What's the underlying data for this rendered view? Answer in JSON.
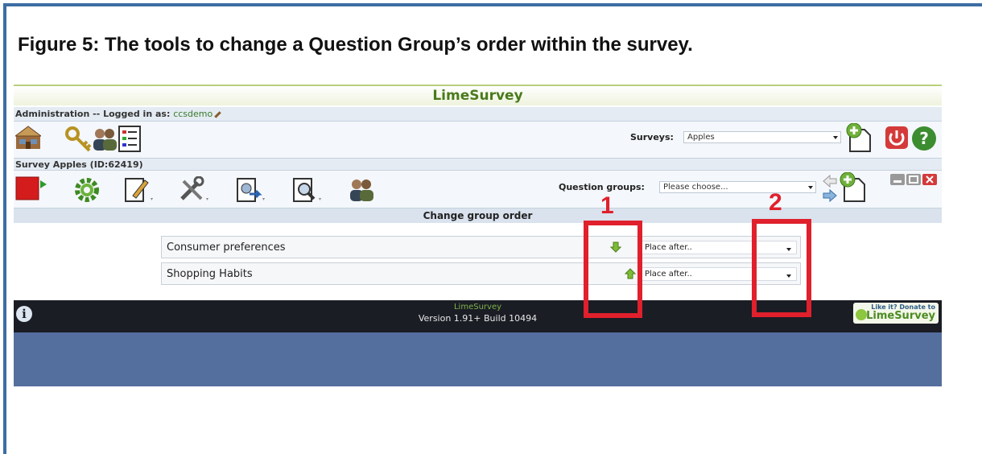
{
  "caption": "Figure 5:  The tools to change a Question Group’s order within the survey.",
  "app": {
    "title": "LimeSurvey",
    "admin_prefix": "Administration -- Logged in as: ",
    "username": "ccsdemo",
    "surveys_label": "Surveys:",
    "surveys_selected": "Apples",
    "survey_heading": "Survey Apples (ID:62419)",
    "question_groups_label": "Question groups:",
    "question_groups_selected": "Please choose...",
    "section_title": "Change group order",
    "groups": [
      {
        "name": "Consumer preferences",
        "move": "down",
        "place": "Place after.."
      },
      {
        "name": "Shopping Habits",
        "move": "up",
        "place": "Place after.."
      }
    ],
    "footer": {
      "name": "LimeSurvey",
      "version": "Version 1.91+ Build 10494",
      "donate_line1": "Like it? Donate to",
      "donate_line2": "LimeSurvey"
    }
  },
  "annotations": [
    "1",
    "2"
  ],
  "colors": {
    "highlight": "#e0202c",
    "brand_green": "#4a7a1c",
    "frame_blue": "#3d6da3"
  }
}
